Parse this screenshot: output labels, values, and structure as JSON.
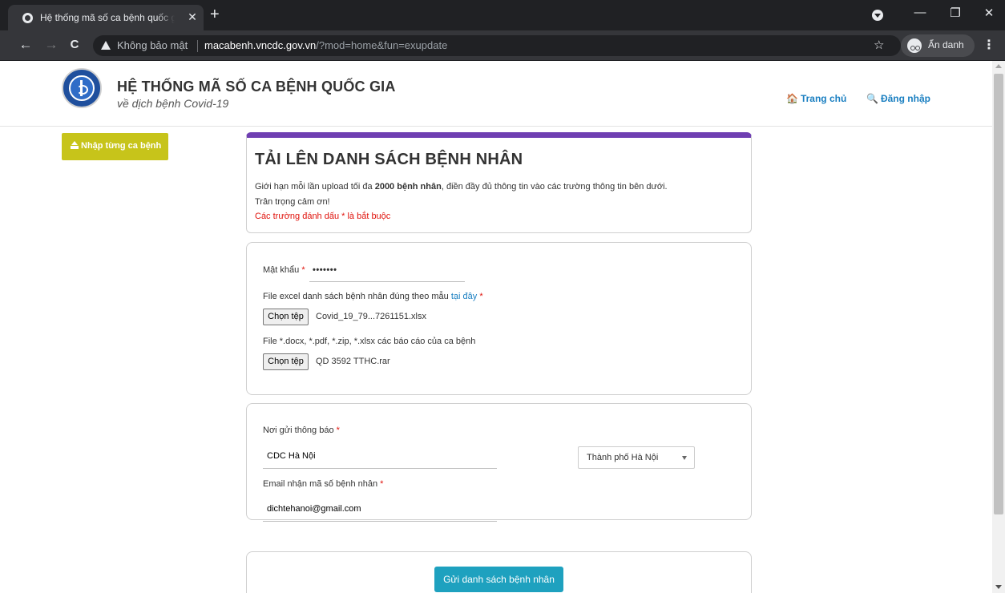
{
  "browser": {
    "tab_title": "Hệ thống mã số ca bệnh quốc gia",
    "tab_close": "✕",
    "new_tab": "+",
    "back": "←",
    "forward": "→",
    "reload": "C",
    "security_label": "Không bảo mật",
    "url_host": "macabenh.vncdc.gov.vn",
    "url_path": "/?mod=home&fun=exupdate",
    "bookmark_icon": "☆",
    "incognito_label": "Ẩn danh",
    "menu": "⋮",
    "window_controls": {
      "minimize": "—",
      "restore": "❐",
      "close": "✕"
    }
  },
  "site": {
    "title": "HỆ THỐNG MÃ SỐ CA BỆNH QUỐC GIA",
    "subtitle": "về dịch bệnh Covid-19",
    "nav": {
      "home_icon": "🏠",
      "home": "Trang chủ",
      "login_icon": "🔍",
      "login": "Đăng nhập"
    }
  },
  "sidebar": {
    "import_single_label": "Nhập từng ca bệnh"
  },
  "upload_card": {
    "title": "TẢI LÊN DANH SÁCH BỆNH NHÂN",
    "intro_before": "Giới hạn mỗi lần upload tối đa ",
    "intro_bold": "2000 bệnh nhân",
    "intro_after": ", điền đầy đủ thông tin vào các trường thông tin bên dưới.",
    "thanks": "Trân trọng cảm ơn!",
    "required_note": "Các trường đánh dấu * là bắt buộc"
  },
  "form": {
    "password_label": "Mật khẩu",
    "required_mark": "*",
    "password_value": "•••••••",
    "excel_label": "File excel danh sách bệnh nhân đúng theo mẫu",
    "excel_link": "tại đây",
    "choose_file": "Chọn tệp",
    "excel_file": "Covid_19_79...7261151.xlsx",
    "attach_label": "File *.docx, *.pdf, *.zip, *.xlsx các báo cáo của ca bệnh",
    "attach_file": "QD 3592 TTHC.rar"
  },
  "notify": {
    "sender_label": "Nơi gửi thông báo",
    "sender_value": "CDC Hà Nội",
    "city_selected": "Thành phố Hà Nội",
    "email_label": "Email nhận mã số bệnh nhân",
    "email_value": "dichtehanoi@gmail.com"
  },
  "submit": {
    "label": "Gửi danh sách bệnh nhân"
  }
}
